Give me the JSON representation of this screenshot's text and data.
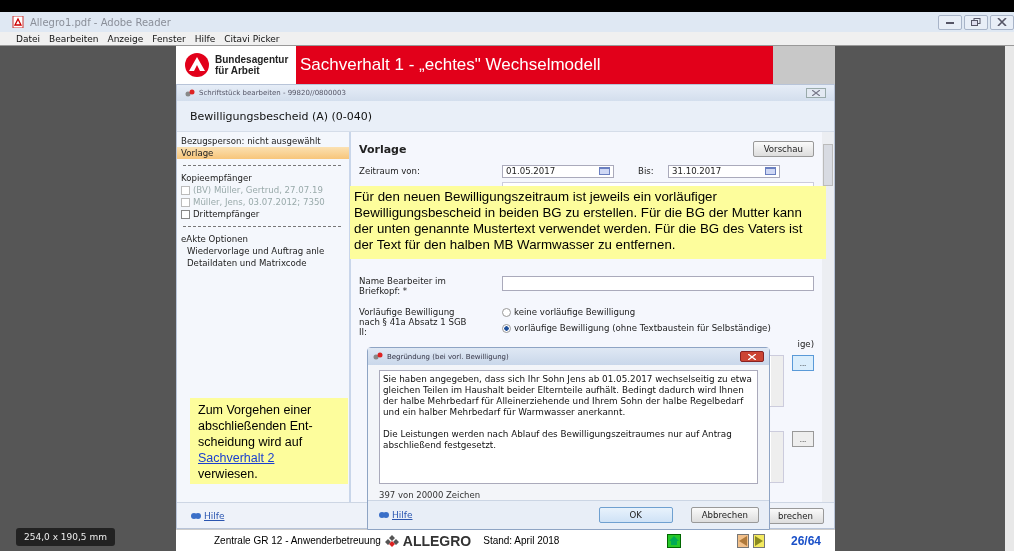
{
  "app": {
    "title": "Allegro1.pdf - Adobe Reader"
  },
  "menu": [
    "Datei",
    "Bearbeiten",
    "Anzeige",
    "Fenster",
    "Hilfe",
    "Citavi Picker"
  ],
  "page_size": "254,0 x 190,5 mm",
  "slide": {
    "org": [
      "Bundesagentur",
      "für Arbeit"
    ],
    "title": "Sachverhalt 1 - „echtes\" Wechselmodell"
  },
  "window": {
    "title": "Schriftstück bearbeiten - 99820//0800003",
    "heading": "Bewilligungsbescheid (A) (0-040)",
    "nav": [
      {
        "kind": "link",
        "label": "Bezugsperson: nicht ausgewählt",
        "selected": false
      },
      {
        "kind": "link",
        "label": "Vorlage",
        "selected": true
      },
      {
        "kind": "divider"
      },
      {
        "kind": "heading",
        "label": "Kopieempfänger"
      },
      {
        "kind": "checkbox",
        "label": "(BV) Müller, Gertrud, 27.07.19",
        "checked": false,
        "disabled": true
      },
      {
        "kind": "checkbox",
        "label": "Müller, Jens, 03.07.2012; 7350",
        "checked": false,
        "disabled": true
      },
      {
        "kind": "checkbox",
        "label": "Drittempfänger",
        "checked": false,
        "disabled": false
      },
      {
        "kind": "divider"
      },
      {
        "kind": "heading",
        "label": "eAkte Optionen"
      },
      {
        "kind": "sub",
        "label": "Wiedervorlage und Auftrag anle"
      },
      {
        "kind": "sub",
        "label": "Detaildaten und Matrixcode"
      }
    ],
    "form": {
      "section": "Vorlage",
      "preview_button": "Vorschau",
      "period": {
        "label": "Zeitraum von:",
        "from": "01.05.2017",
        "to_label": "Bis:",
        "to": "31.10.2017"
      },
      "editor_name": {
        "label": "Name Bearbeiter im Briefkopf: *"
      },
      "provisional": {
        "label": "Vorläufige Bewilligung nach § 41a Absatz 1 SGB II:",
        "options": [
          {
            "kind": "radio",
            "label": "keine vorläufige Bewilligung",
            "selected": false
          },
          {
            "kind": "radio",
            "label": "vorläufige Bewilligung (ohne Textbaustein für Selbständige)",
            "selected": true
          },
          {
            "kind": "fragment",
            "label": "ige)"
          }
        ]
      },
      "text_rows": [
        {
          "button": "...",
          "focused": true
        },
        {
          "button": "...",
          "focused": false
        }
      ]
    },
    "help": "Hilfe",
    "cancel_fragment": "brechen"
  },
  "notes": [
    {
      "text": "Für den neuen Bewilligungszeitraum ist jeweils ein vorläufiger Bewilligungsbescheid in beiden BG zu erstellen. Für die BG der Mutter kann der unten genannte Mustertext verwendet werden. Für die BG des Vaters ist der Text für den halben MB Warmwasser zu entfernen."
    },
    {
      "text": "Zum Vorgehen einer abschließenden Ent- scheidung wird auf",
      "link": "Sachverhalt 2",
      "after": "verwiesen."
    }
  ],
  "dialog": {
    "title": "Begründung (bei vorl. Bewilligung)",
    "paragraphs": [
      "Sie haben angegeben, dass sich Ihr Sohn Jens ab 01.05.2017 wechselseitig zu etwa gleichen Teilen im Haushalt beider Elternteile aufhält. Bedingt dadurch wird Ihnen der halbe Mehrbedarf für Alleinerziehende und Ihrem Sohn der halbe Regelbedarf und ein halber Mehrbedarf für Warmwasser anerkannt.",
      "Die Leistungen werden nach Ablauf des Bewilligungszeitraumes nur auf Antrag abschließend festgesetzt."
    ],
    "counter": "397 von 20000 Zeichen",
    "help": "Hilfe",
    "ok": "OK",
    "cancel": "Abbrechen"
  },
  "footer": {
    "text": "Zentrale GR 12 - Anwenderbetreuung",
    "brand": "ALLEGRO",
    "stand": "Stand: April 2018",
    "page": "26/64"
  }
}
